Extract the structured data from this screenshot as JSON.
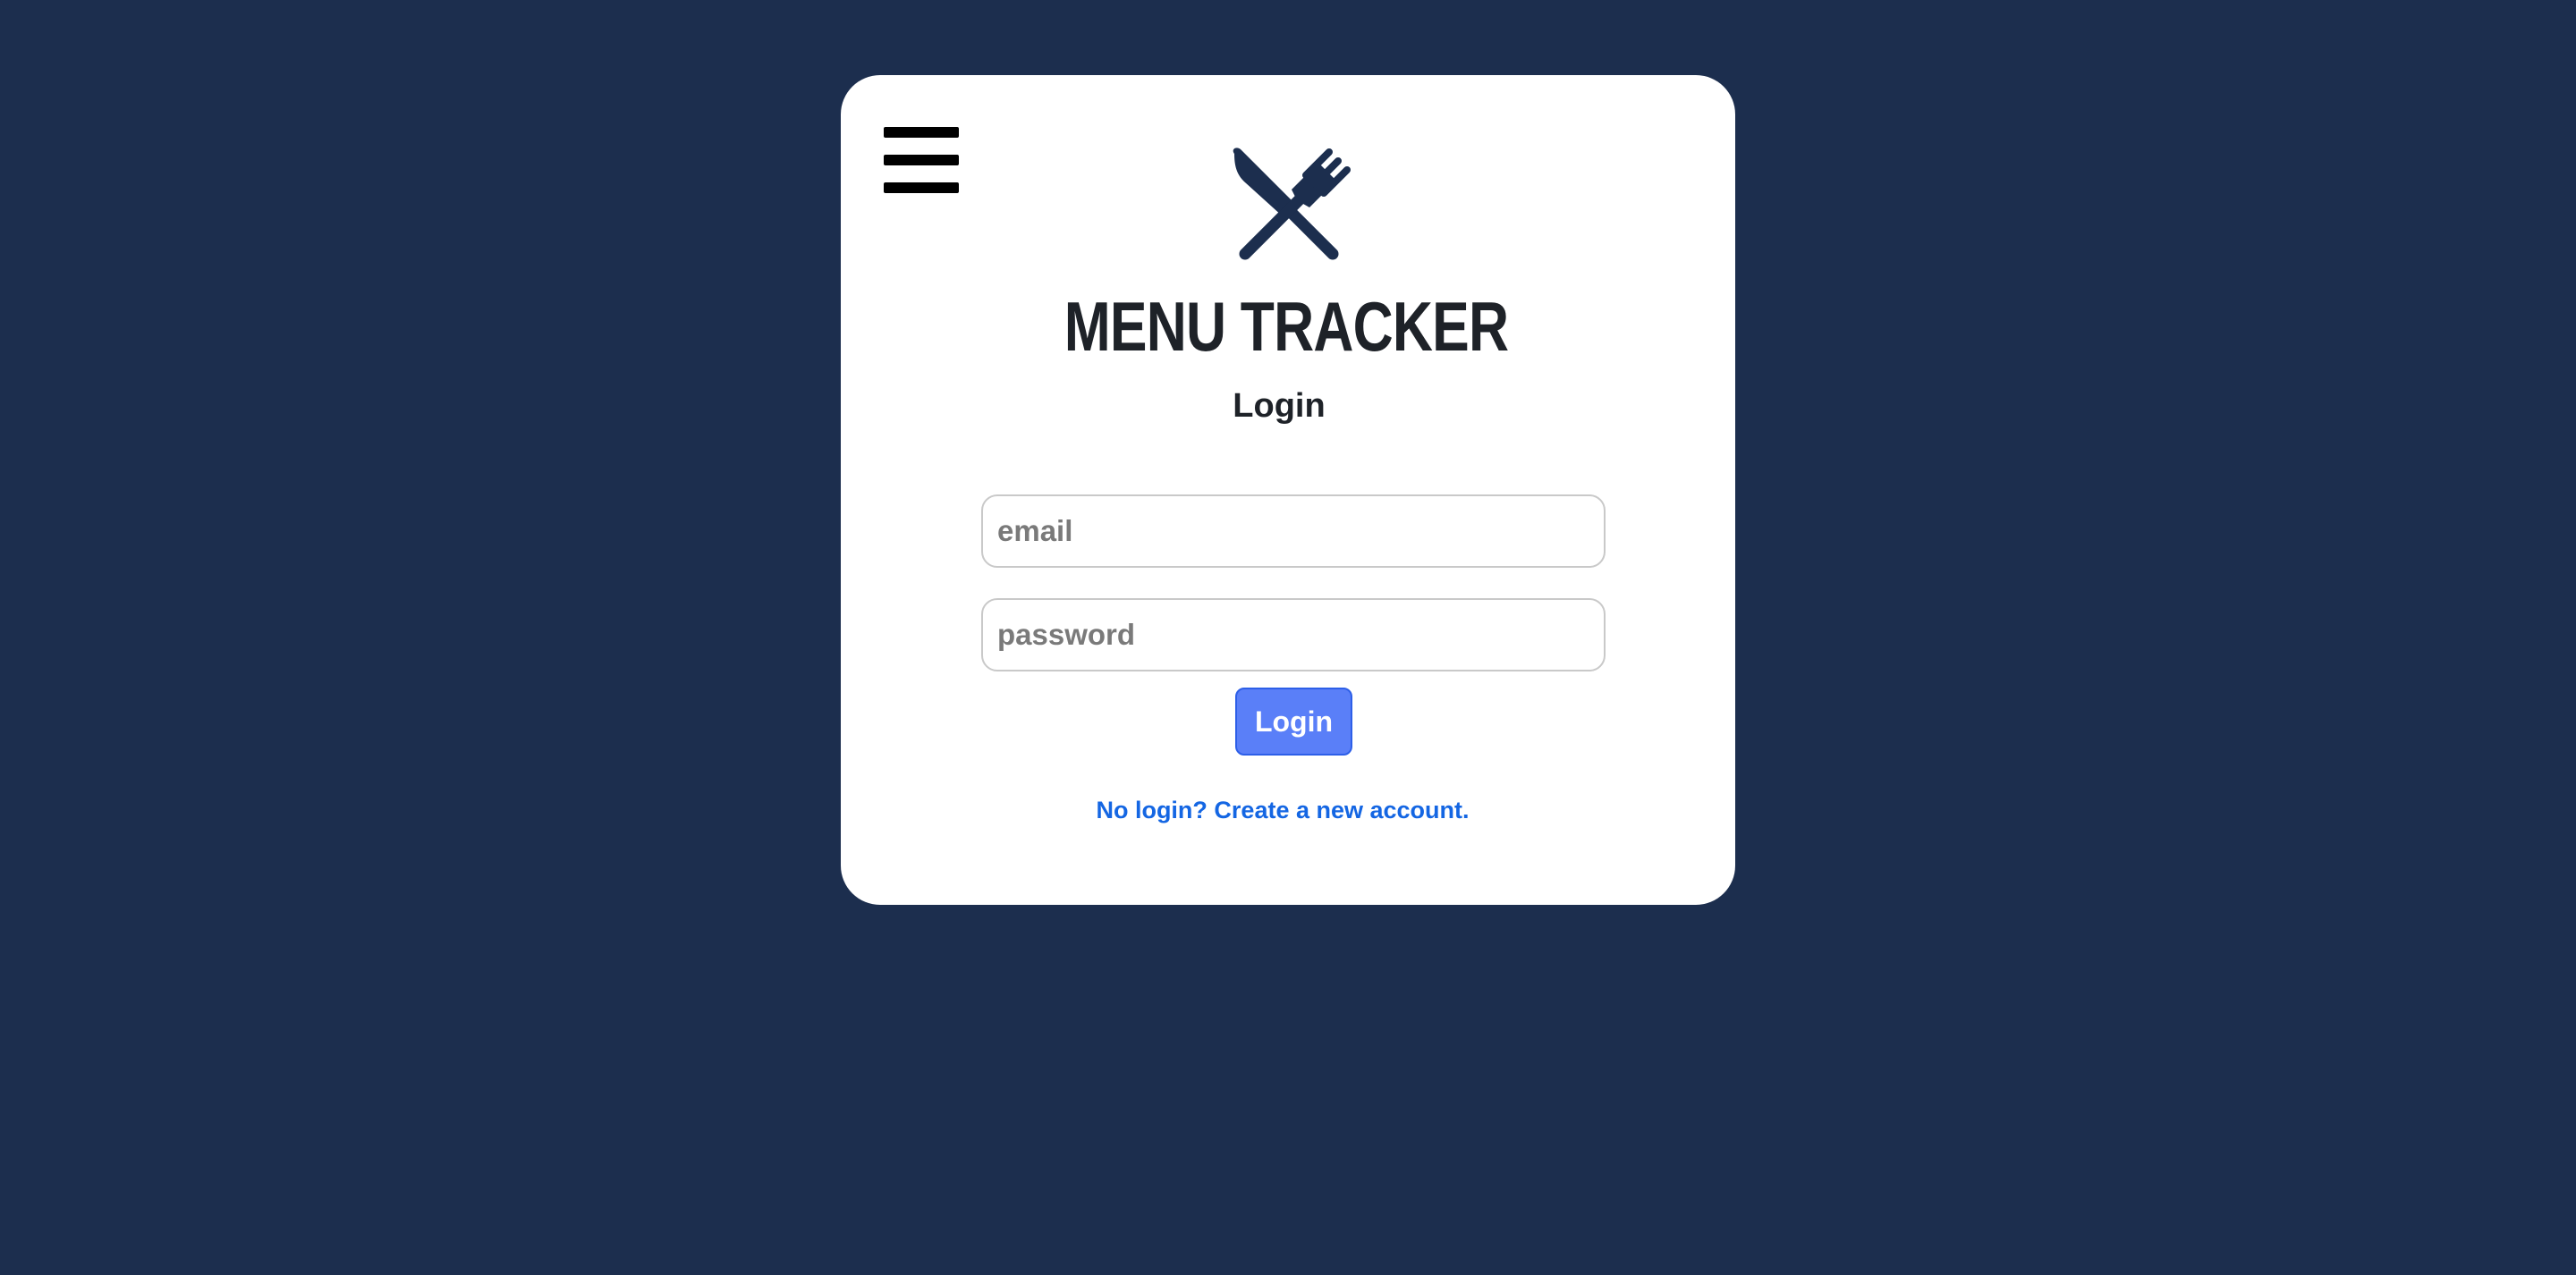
{
  "app": {
    "title": "MENU TRACKER",
    "logo_icon": "utensils-icon"
  },
  "nav": {
    "menu_icon": "hamburger-menu-icon"
  },
  "login_form": {
    "heading": "Login",
    "email_placeholder": "email",
    "email_value": "",
    "password_placeholder": "password",
    "password_value": "",
    "submit_label": "Login",
    "signup_link": "No login? Create a new account."
  },
  "colors": {
    "background": "#1c2e4e",
    "card": "#ffffff",
    "logo": "#1c2e4e",
    "button": "#5a7ff8",
    "link": "#1466e3"
  }
}
